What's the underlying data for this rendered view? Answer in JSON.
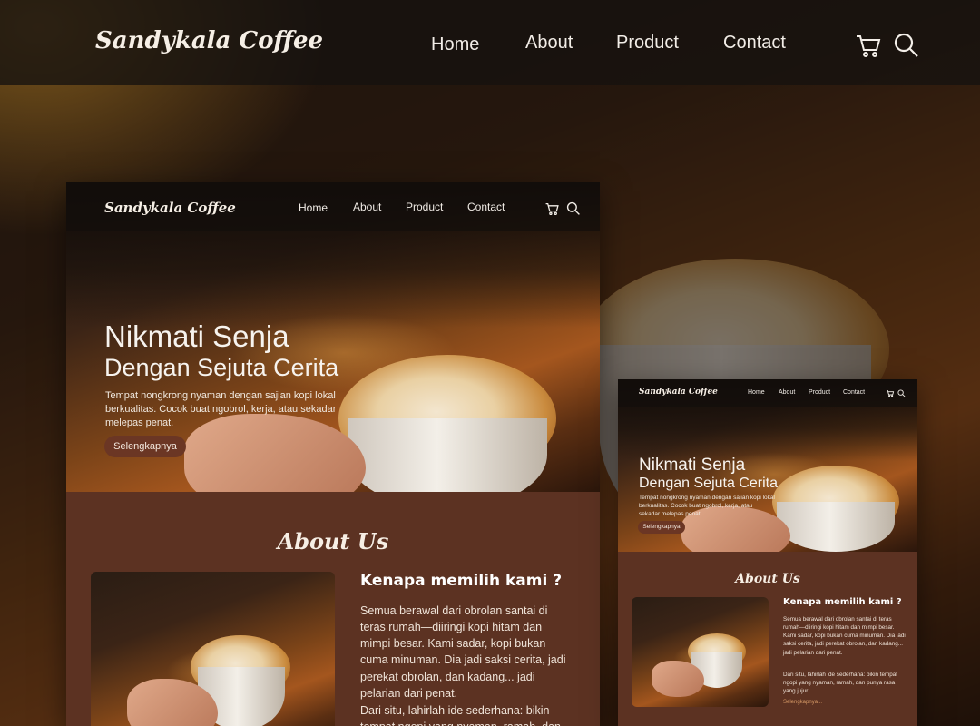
{
  "site": {
    "brand": "Sandykala Coffee",
    "nav": [
      {
        "label": "Home"
      },
      {
        "label": "About"
      },
      {
        "label": "Product"
      },
      {
        "label": "Contact"
      }
    ],
    "icons": {
      "cart": "cart-icon",
      "search": "search-icon"
    }
  },
  "hero": {
    "title_line1": "Nikmati Senja",
    "title_line2": "Dengan Sejuta Cerita",
    "description": "Tempat nongkrong nyaman dengan sajian kopi lokal berkualitas. Cocok buat ngobrol, kerja, atau sekadar melepas penat.",
    "cta": "Selengkapnya"
  },
  "about": {
    "heading": "About Us",
    "subheading": "Kenapa memilih kami ?",
    "paragraph1": "Semua berawal dari obrolan santai di teras rumah—diiringi kopi hitam dan mimpi besar. Kami sadar, kopi bukan cuma minuman. Dia jadi saksi cerita, jadi perekat obrolan, dan kadang... jadi pelarian dari penat.",
    "paragraph2": "Dari situ, lahirlah ide sederhana: bikin tempat ngopi yang nyaman, ramah, dan punya rasa yang jujur.",
    "read_more": "Selengkapnya..."
  },
  "colors": {
    "brown_section": "#5c3222",
    "button": "#6b3624",
    "navbar": "#161210",
    "text_light": "#f6efe6"
  }
}
